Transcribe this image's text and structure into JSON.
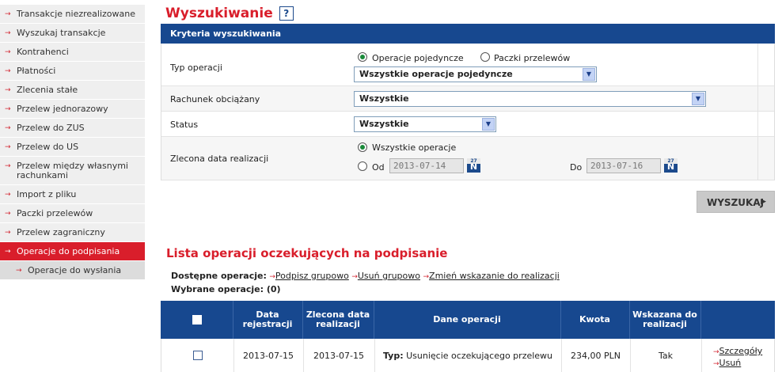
{
  "sidebar": {
    "items": [
      {
        "label": "Transakcje niezrealizowane"
      },
      {
        "label": "Wyszukaj transakcje"
      },
      {
        "label": "Kontrahenci"
      },
      {
        "label": "Płatności"
      },
      {
        "label": "Zlecenia stałe"
      },
      {
        "label": "Przelew jednorazowy"
      },
      {
        "label": "Przelew do ZUS"
      },
      {
        "label": "Przelew do US"
      },
      {
        "label": "Przelew między własnymi rachunkami"
      },
      {
        "label": "Import z pliku"
      },
      {
        "label": "Paczki przelewów"
      },
      {
        "label": "Przelew zagraniczny"
      },
      {
        "label": "Operacje do podpisania"
      },
      {
        "label": "Operacje do wysłania"
      }
    ],
    "arrow_icon": "→"
  },
  "header": {
    "title": "Wyszukiwanie",
    "help": "?"
  },
  "criteria": {
    "title": "Kryteria wyszukiwania",
    "typ_label": "Typ operacji",
    "typ_radio1": "Operacje pojedyncze",
    "typ_radio2": "Paczki przelewów",
    "typ_select": "Wszystkie operacje pojedyncze",
    "rachunek_label": "Rachunek obciążany",
    "rachunek_select": "Wszystkie",
    "status_label": "Status",
    "status_select": "Wszystkie",
    "data_label": "Zlecona data realizacji",
    "data_radio1": "Wszystkie operacje",
    "od_label": "Od",
    "od_value": "2013-07-14",
    "do_label": "Do",
    "do_value": "2013-07-16",
    "cal_top": "27",
    "cal_letter": "N"
  },
  "search_button": "WYSZUKAJ",
  "list": {
    "title": "Lista operacji oczekujących na podpisanie",
    "available_label": "Dostępne operacje:",
    "op1": "Podpisz grupowo",
    "op2": "Usuń grupowo",
    "op3": "Zmień wskazanie do realizacji",
    "chosen": "Wybrane operacje: (0)",
    "columns": {
      "reg": "Data rejestracji",
      "ordered": "Zlecona data realizacji",
      "details": "Dane operacji",
      "amount": "Kwota",
      "indicated": "Wskazana do realizacji"
    },
    "rows": [
      {
        "reg": "2013-07-15",
        "ordered": "2013-07-15",
        "type_label": "Typ:",
        "type_value": "Usunięcie oczekującego przelewu",
        "amount": "234,00 PLN",
        "indicated": "Tak",
        "link1": "Szczegóły",
        "link2": "Usuń"
      }
    ]
  },
  "colors": {
    "brand_red": "#d91e2b",
    "navy": "#17488f"
  }
}
